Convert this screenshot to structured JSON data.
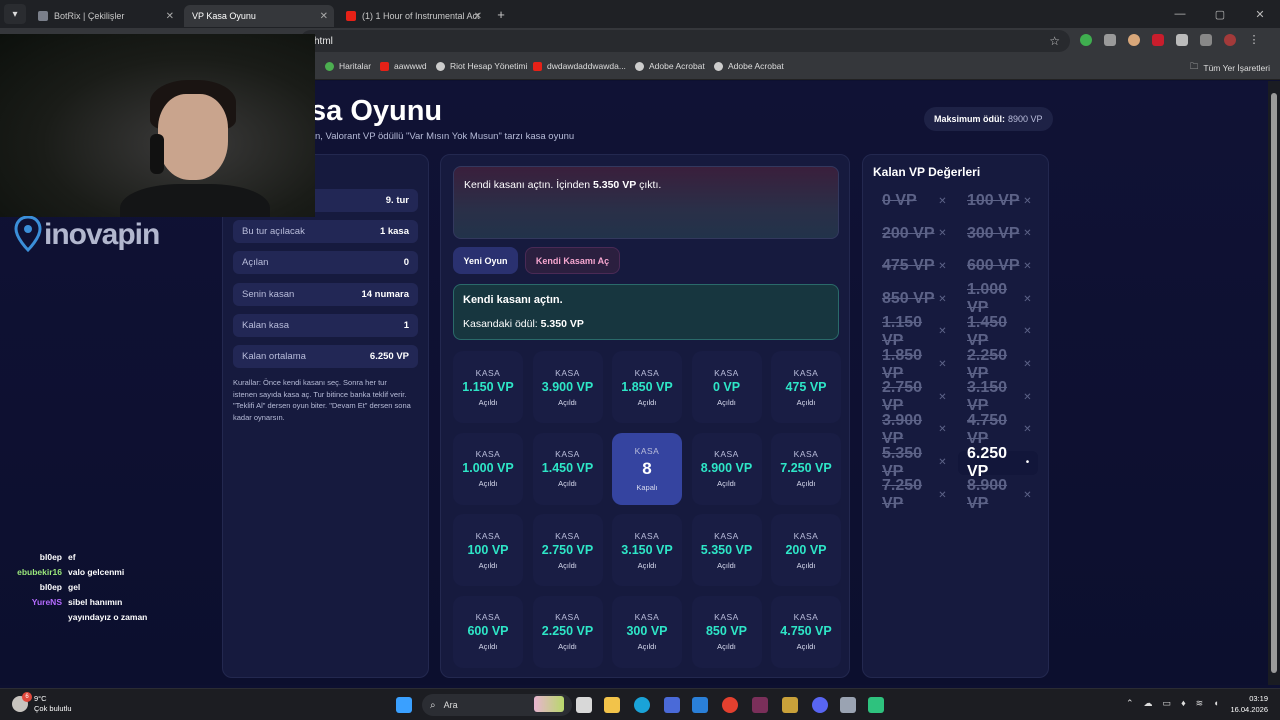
{
  "browser": {
    "tabs": [
      {
        "title": "BotRix | Çekilişler",
        "color": "#7a7f8a"
      },
      {
        "title": "VP Kasa Oyunu",
        "color": "#8a8fa0"
      },
      {
        "title": "(1) 1 Hour of Instrumental Acti",
        "color": "#e62117"
      }
    ],
    "url": "html",
    "bookmarks": [
      {
        "label": "Haritalar",
        "color": "#4caf50"
      },
      {
        "label": "aawwwd",
        "color": "#e62117"
      },
      {
        "label": "Riot Hesap Yönetimi",
        "color": "#cccccc"
      },
      {
        "label": "dwdawdaddwawda...",
        "color": "#e62117"
      },
      {
        "label": "Adobe Acrobat",
        "color": "#cccccc"
      },
      {
        "label": "Adobe Acrobat",
        "color": "#cccccc"
      }
    ],
    "all_bookmarks": "Tüm Yer İşaretleri"
  },
  "header": {
    "title": "sa Oyunu",
    "subtitle": "n, Valorant VP ödüllü \"Var Mısın Yok Musun\" tarzı kasa oyunu",
    "max_label": "Maksimum ödül:",
    "max_value": "8900 VP"
  },
  "stats": [
    {
      "label": "",
      "value": "9. tur"
    },
    {
      "label": "Bu tur açılacak",
      "value": "1 kasa"
    },
    {
      "label": "Açılan",
      "value": "0"
    },
    {
      "label": "Senin kasan",
      "value": "14 numara"
    },
    {
      "label": "Kalan kasa",
      "value": "1"
    },
    {
      "label": "Kalan ortalama",
      "value": "6.250 VP"
    }
  ],
  "rules": "Kurallar: Önce kendi kasanı seç. Sonra her tur istenen sayıda kasa aç. Tur bitince banka teklif verir. \"Teklifi Al\" dersen oyun biter. \"Devam Et\" dersen sona kadar oynarsın.",
  "message": {
    "prefix": "Kendi kasanı açtın. İçinden ",
    "amount": "5.350 VP",
    "suffix": " çıktı."
  },
  "buttons": {
    "new_game": "Yeni Oyun",
    "open_own": "Kendi Kasamı Aç"
  },
  "info": {
    "title": "Kendi kasanı açtın.",
    "prize_label": "Kasandaki ödül: ",
    "prize_value": "5.350 VP"
  },
  "cases": [
    {
      "kasa": "KASA",
      "value": "1.150 VP",
      "status": "Açıldı"
    },
    {
      "kasa": "KASA",
      "value": "3.900 VP",
      "status": "Açıldı"
    },
    {
      "kasa": "KASA",
      "value": "1.850 VP",
      "status": "Açıldı"
    },
    {
      "kasa": "KASA",
      "value": "0 VP",
      "status": "Açıldı"
    },
    {
      "kasa": "KASA",
      "value": "475 VP",
      "status": "Açıldı"
    },
    {
      "kasa": "KASA",
      "value": "1.000 VP",
      "status": "Açıldı"
    },
    {
      "kasa": "KASA",
      "value": "1.450 VP",
      "status": "Açıldı"
    },
    {
      "kasa": "KASA",
      "value": "8",
      "status": "Kapalı",
      "closed": true
    },
    {
      "kasa": "KASA",
      "value": "8.900 VP",
      "status": "Açıldı"
    },
    {
      "kasa": "KASA",
      "value": "7.250 VP",
      "status": "Açıldı"
    },
    {
      "kasa": "KASA",
      "value": "100 VP",
      "status": "Açıldı"
    },
    {
      "kasa": "KASA",
      "value": "2.750 VP",
      "status": "Açıldı"
    },
    {
      "kasa": "KASA",
      "value": "3.150 VP",
      "status": "Açıldı"
    },
    {
      "kasa": "KASA",
      "value": "5.350 VP",
      "status": "Açıldı"
    },
    {
      "kasa": "KASA",
      "value": "200 VP",
      "status": "Açıldı"
    },
    {
      "kasa": "KASA",
      "value": "600 VP",
      "status": "Açıldı"
    },
    {
      "kasa": "KASA",
      "value": "2.250 VP",
      "status": "Açıldı"
    },
    {
      "kasa": "KASA",
      "value": "300 VP",
      "status": "Açıldı"
    },
    {
      "kasa": "KASA",
      "value": "850 VP",
      "status": "Açıldı"
    },
    {
      "kasa": "KASA",
      "value": "4.750 VP",
      "status": "Açıldı"
    }
  ],
  "remaining": {
    "title": "Kalan VP Değerleri",
    "values": [
      {
        "value": "0 VP",
        "mark": "✕",
        "active": false
      },
      {
        "value": "100 VP",
        "mark": "✕",
        "active": false
      },
      {
        "value": "200 VP",
        "mark": "✕",
        "active": false
      },
      {
        "value": "300 VP",
        "mark": "✕",
        "active": false
      },
      {
        "value": "475 VP",
        "mark": "✕",
        "active": false
      },
      {
        "value": "600 VP",
        "mark": "✕",
        "active": false
      },
      {
        "value": "850 VP",
        "mark": "✕",
        "active": false
      },
      {
        "value": "1.000 VP",
        "mark": "✕",
        "active": false
      },
      {
        "value": "1.150 VP",
        "mark": "✕",
        "active": false
      },
      {
        "value": "1.450 VP",
        "mark": "✕",
        "active": false
      },
      {
        "value": "1.850 VP",
        "mark": "✕",
        "active": false
      },
      {
        "value": "2.250 VP",
        "mark": "✕",
        "active": false
      },
      {
        "value": "2.750 VP",
        "mark": "✕",
        "active": false
      },
      {
        "value": "3.150 VP",
        "mark": "✕",
        "active": false
      },
      {
        "value": "3.900 VP",
        "mark": "✕",
        "active": false
      },
      {
        "value": "4.750 VP",
        "mark": "✕",
        "active": false
      },
      {
        "value": "5.350 VP",
        "mark": "✕",
        "active": false
      },
      {
        "value": "6.250 VP",
        "mark": "•",
        "active": true
      },
      {
        "value": "7.250 VP",
        "mark": "✕",
        "active": false
      },
      {
        "value": "8.900 VP",
        "mark": "✕",
        "active": false
      }
    ]
  },
  "overlay": {
    "logo": "inovapin",
    "chat": [
      {
        "user": "bl0ep",
        "msg": "ef",
        "color": "#ffffff"
      },
      {
        "user": "ebubekir16",
        "msg": "valo gelcenmi",
        "color": "#9be87b"
      },
      {
        "user": "bl0ep",
        "msg": "gel",
        "color": "#ffffff"
      },
      {
        "user": "YureNS",
        "msg": "sibel hanımın",
        "color": "#b46bff"
      },
      {
        "user": "",
        "msg": "yayındayız o zaman",
        "color": "#ffffff"
      }
    ]
  },
  "taskbar": {
    "temp": "9°C",
    "weather": "Çok bulutlu",
    "badge": "6",
    "search": "Ara",
    "time": "03:19",
    "date": "16.04.2026"
  }
}
